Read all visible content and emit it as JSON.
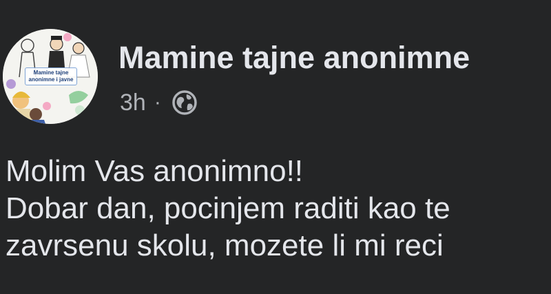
{
  "post": {
    "group_name": "Mamine tajne anonimne",
    "timestamp": "3h",
    "separator": "·",
    "privacy_icon": "globe-icon",
    "avatar_caption": "Mamine tajne anonimne i javne",
    "body_lines": [
      "Molim Vas anonimno!!",
      "Dobar dan, pocinjem raditi kao te",
      "zavrsenu skolu, mozete li mi reci"
    ]
  },
  "colors": {
    "background": "#242526",
    "primary_text": "#e4e6eb",
    "secondary_text": "#b0b3b8"
  }
}
